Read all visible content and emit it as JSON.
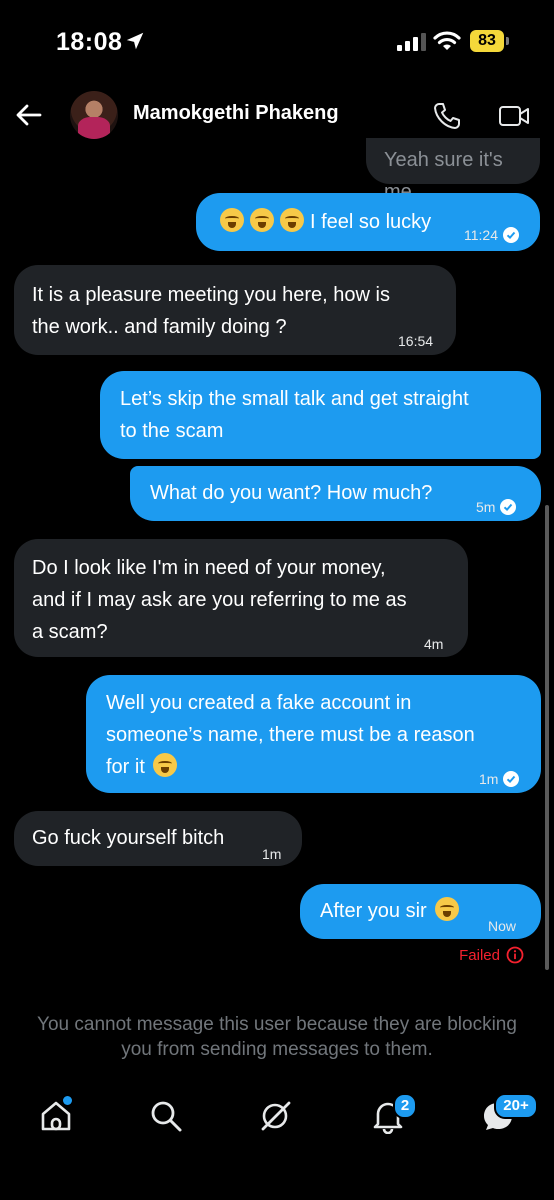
{
  "status_bar": {
    "time": "18:08",
    "battery": "83"
  },
  "header": {
    "contact_name": "Mamokgethi Phakeng"
  },
  "messages": [
    {
      "dir": "in",
      "text": "Yeah sure it's me",
      "time": ""
    },
    {
      "dir": "out",
      "text": "I feel so lucky",
      "time": "11:24",
      "emoji_count": 3
    },
    {
      "dir": "in",
      "text": "It is a pleasure meeting you here, how is\nthe work.. and family doing ?",
      "time": "16:54"
    },
    {
      "dir": "out",
      "text": "Let’s skip the small talk and get straight\nto the scam",
      "time": ""
    },
    {
      "dir": "out",
      "text": "What do you want? How much?",
      "time": "5m"
    },
    {
      "dir": "in",
      "text": "Do I look like I'm in need of your money,\nand if I may ask are you referring to me as\na scam?",
      "time": "4m"
    },
    {
      "dir": "out",
      "text": "Well you created a fake account in\nsomeone’s name, there must be a reason\nfor it",
      "time": "1m"
    },
    {
      "dir": "in",
      "text": "Go fuck yourself bitch",
      "time": "1m"
    },
    {
      "dir": "out",
      "text": "After you sir",
      "time": "Now"
    }
  ],
  "failed_label": "Failed",
  "blocked_note": "You cannot message this user because they are blocking you from sending messages to them.",
  "nav": {
    "notifications_badge": "2",
    "messages_badge": "20+"
  },
  "colors": {
    "accent": "#1d9bf0",
    "incoming_bubble": "#202327",
    "error": "#f4212e",
    "background": "#000000"
  },
  "icons": [
    "location-arrow-icon",
    "signal-icon",
    "wifi-icon",
    "back-arrow-icon",
    "phone-icon",
    "video-call-icon",
    "home-icon",
    "search-icon",
    "grok-icon",
    "bell-icon",
    "messages-icon",
    "check-circle-icon",
    "info-icon"
  ]
}
